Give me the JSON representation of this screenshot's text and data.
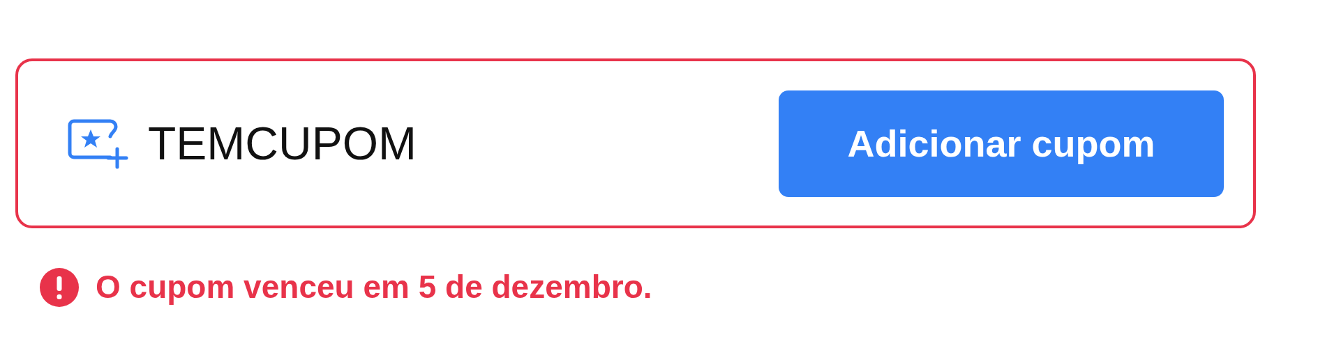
{
  "coupon_field": {
    "value": "TEMCUPOM",
    "invalid": true
  },
  "apply_button": {
    "label": "Adicionar cupom"
  },
  "error": {
    "message": "O cupom venceu em 5 de dezembro."
  }
}
